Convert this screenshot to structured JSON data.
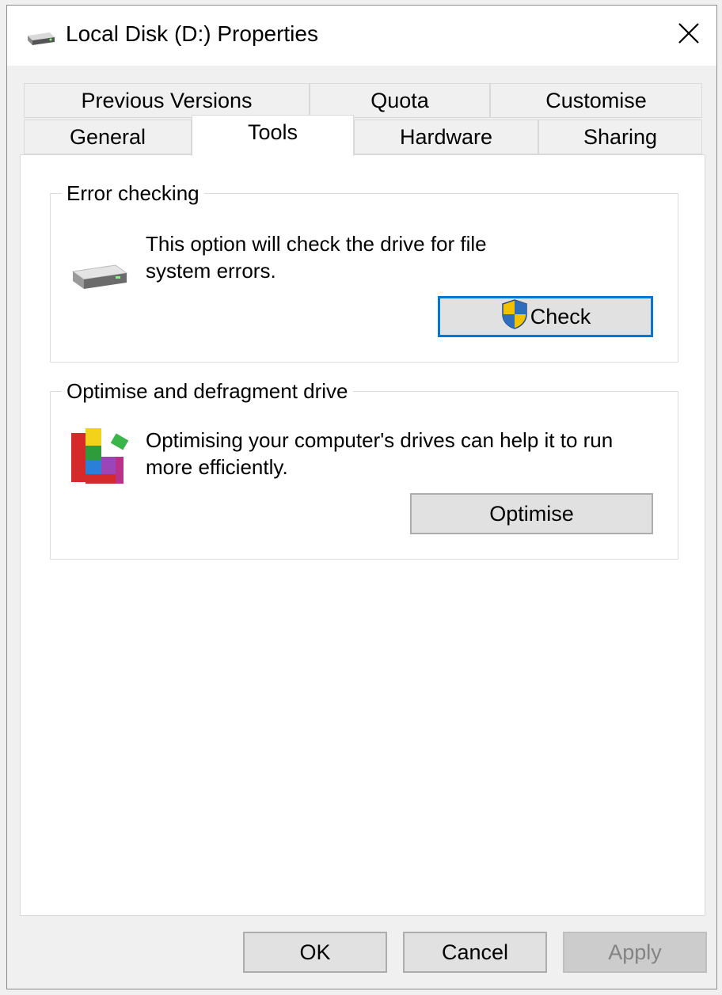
{
  "window": {
    "title": "Local Disk (D:) Properties",
    "icon": "drive-icon",
    "close_icon": "close-icon"
  },
  "tabs": {
    "row_top": [
      {
        "label": "Previous Versions"
      },
      {
        "label": "Quota"
      },
      {
        "label": "Customise"
      }
    ],
    "row_bottom": [
      {
        "label": "General"
      },
      {
        "label": "Tools"
      },
      {
        "label": "Hardware"
      },
      {
        "label": "Sharing"
      }
    ],
    "active": "Tools"
  },
  "error_checking": {
    "label": "Error checking",
    "description_line1": "This option will check the drive for file",
    "description_line2": "system errors.",
    "button_label": "Check",
    "button_icon": "uac-shield-icon",
    "icon": "drive-icon"
  },
  "optimise": {
    "label": "Optimise and defragment drive",
    "description_line1": "Optimising your computer's drives can help it to run",
    "description_line2": "more efficiently.",
    "button_label": "Optimise",
    "icon": "defrag-icon"
  },
  "footer": {
    "ok_label": "OK",
    "cancel_label": "Cancel",
    "apply_label": "Apply"
  },
  "colors": {
    "focus_border": "#0078d7",
    "button_bg": "#e1e1e1",
    "disabled_text": "#838383"
  }
}
